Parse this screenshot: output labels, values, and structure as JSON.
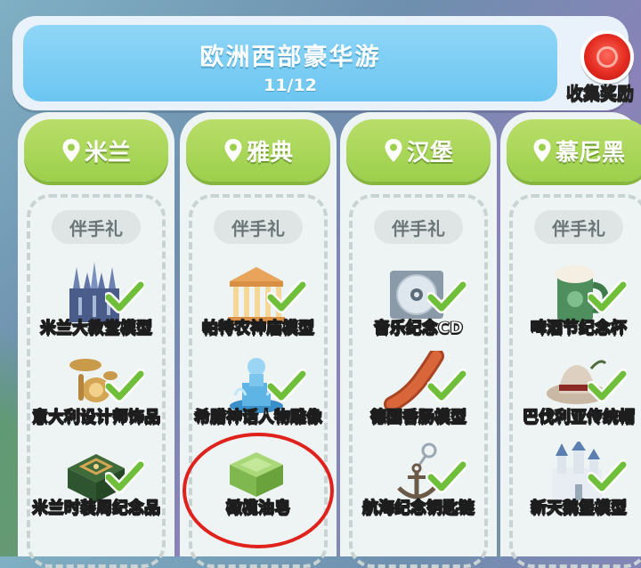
{
  "header": {
    "title": "欧洲西部豪华游",
    "progress": "11/12",
    "reward_label": "收集奖励"
  },
  "gift_label": "伴手礼",
  "colors": {
    "header_blue": "#6cc6f1",
    "city_green": "#9ccf4b",
    "check_green": "#6fbf3a",
    "highlight_red": "#e0221d"
  },
  "columns": [
    {
      "city": "米兰",
      "items": [
        {
          "label": "米兰大教堂模型",
          "icon": "cathedral-icon",
          "collected": true
        },
        {
          "label": "意大利设计师饰品",
          "icon": "jewelry-icon",
          "collected": true
        },
        {
          "label": "米兰时装周纪念品",
          "icon": "fashion-box-icon",
          "collected": true
        }
      ]
    },
    {
      "city": "雅典",
      "items": [
        {
          "label": "帕特农神庙模型",
          "icon": "temple-icon",
          "collected": true
        },
        {
          "label": "希腊神话人物雕像",
          "icon": "statue-icon",
          "collected": true
        },
        {
          "label": "橄榄油皂",
          "icon": "soap-icon",
          "collected": false
        }
      ]
    },
    {
      "city": "汉堡",
      "items": [
        {
          "label": "音乐纪念CD",
          "icon": "cd-icon",
          "collected": true
        },
        {
          "label": "德国香肠模型",
          "icon": "sausage-icon",
          "collected": true
        },
        {
          "label": "航海纪念钥匙链",
          "icon": "anchor-keychain-icon",
          "collected": true
        }
      ]
    },
    {
      "city": "慕尼黑",
      "items": [
        {
          "label": "啤酒节纪念杯",
          "icon": "beer-mug-icon",
          "collected": true
        },
        {
          "label": "巴伐利亚传统帽",
          "icon": "hat-icon",
          "collected": true
        },
        {
          "label": "新天鹅堡模型",
          "icon": "castle-icon",
          "collected": true
        }
      ]
    }
  ]
}
